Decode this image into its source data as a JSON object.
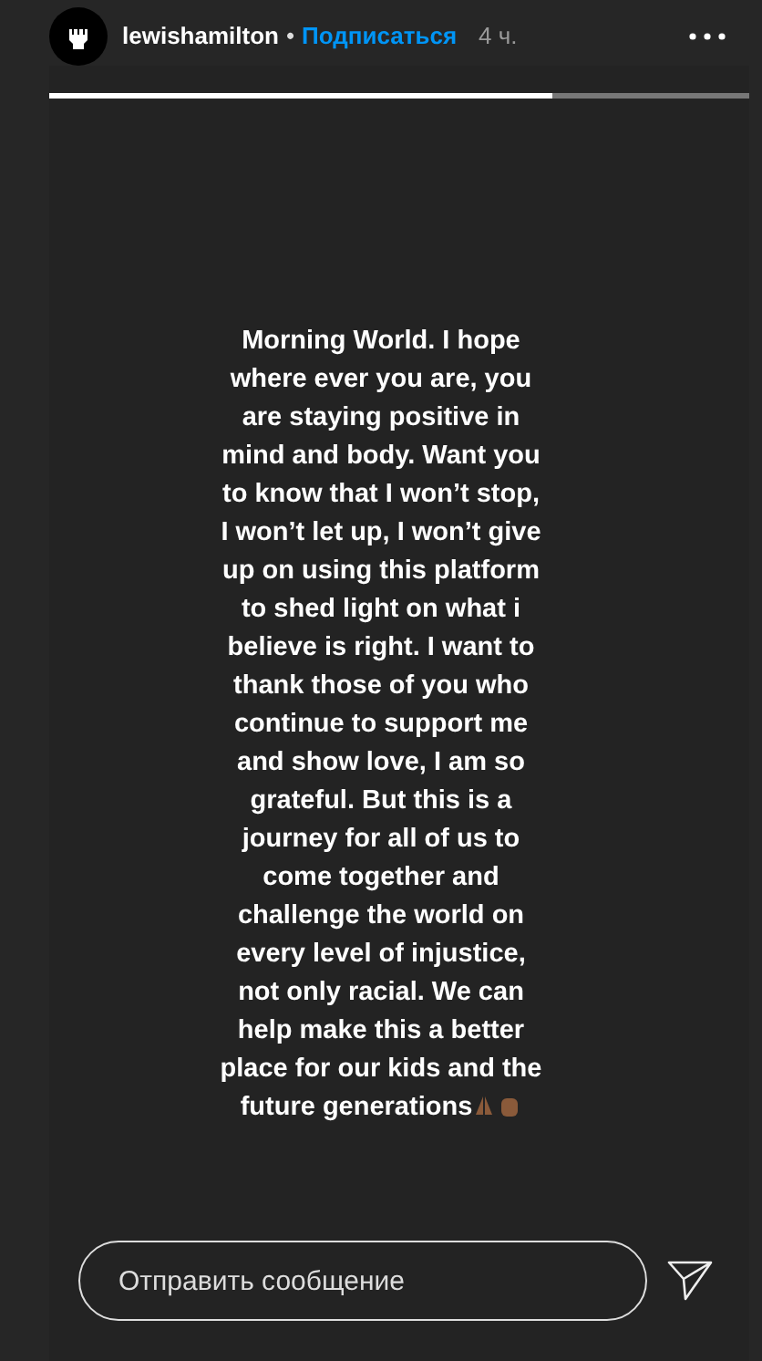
{
  "header": {
    "username": "lewishamilton",
    "separator": "•",
    "follow": "Подписаться",
    "time": "4 ч."
  },
  "progress": [
    {
      "level": 0.72
    }
  ],
  "story_text": [
    "Morning World. I hope",
    "where ever you are, you",
    "are staying positive in",
    "mind and body. Want you",
    "to know that I won’t stop,",
    "I won’t let up, I won’t give",
    "up on using this platform",
    "to shed light on what i",
    "believe is right. I want to",
    "thank those of you who",
    "continue to support me",
    "and show love, I am so",
    "grateful. But this is a",
    "journey for all of us to",
    "come together and",
    "challenge the world on",
    "every level of injustice,",
    "not only racial. We can",
    "help make this a better",
    "place for our kids and the",
    "future generations"
  ],
  "reply": {
    "placeholder": "Отправить сообщение"
  }
}
